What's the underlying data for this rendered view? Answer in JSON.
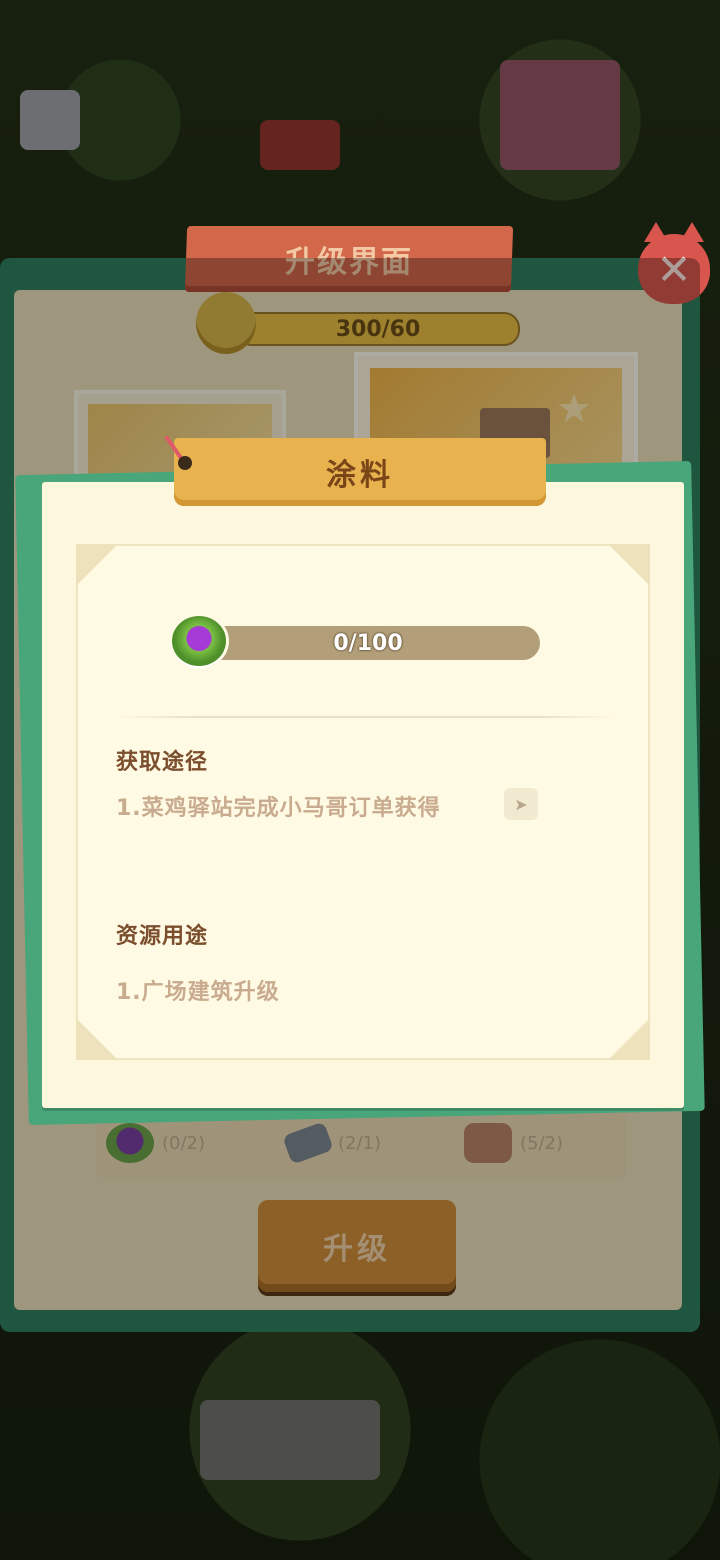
{
  "upgrade_screen": {
    "title": "升级界面",
    "exp_text": "300/60",
    "close_symbol": "✕",
    "costs": [
      {
        "icon": "paint-icon",
        "text": "(0/2)"
      },
      {
        "icon": "hammer-icon",
        "text": "(2/1)"
      },
      {
        "icon": "brick-icon",
        "text": "(5/2)"
      }
    ],
    "upgrade_button_label": "升级"
  },
  "popup": {
    "title": "涂料",
    "progress_text": "0/100",
    "progress_fraction": 0,
    "obtain_heading": "获取途径",
    "obtain_item_1": "1.菜鸡驿站完成小马哥订单获得",
    "go_symbol": "➤",
    "usage_heading": "资源用途",
    "usage_item_1": "1.广场建筑升级"
  },
  "colors": {
    "accent_green": "#49a57a",
    "ribbon_yellow": "#e8b24f",
    "ribbon_red": "#d2674a",
    "heading_brown": "#7b4f2e"
  }
}
